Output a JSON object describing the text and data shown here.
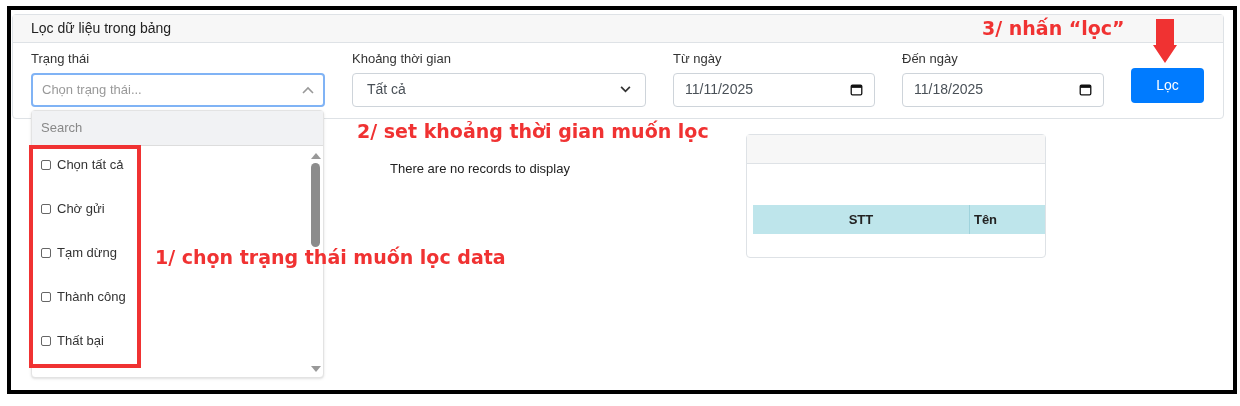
{
  "filter_panel": {
    "title": "Lọc dữ liệu trong bảng",
    "status_field": {
      "label": "Trạng thái",
      "placeholder": "Chọn trạng thái...",
      "expanded": true
    },
    "period_field": {
      "label": "Khoảng thời gian",
      "value": "Tất cả"
    },
    "from_date": {
      "label": "Từ ngày",
      "value": "11/11/2025"
    },
    "to_date": {
      "label": "Đến ngày",
      "value": "11/18/2025"
    },
    "filter_button": "Lọc"
  },
  "status_dropdown": {
    "search_placeholder": "Search",
    "options": [
      {
        "label": "Chọn tất cả",
        "checked": false
      },
      {
        "label": "Chờ gửi",
        "checked": false
      },
      {
        "label": "Tạm dừng",
        "checked": false
      },
      {
        "label": "Thành công",
        "checked": false
      },
      {
        "label": "Thất bại",
        "checked": false
      }
    ]
  },
  "empty_message": "There are no records to display",
  "table": {
    "columns": [
      "STT",
      "Tên"
    ]
  },
  "annotations": [
    {
      "kind": "step-status",
      "text": "1/ chọn trạng thái muốn lọc data"
    },
    {
      "kind": "step-period",
      "text": "2/ set khoảng thời gian muốn lọc"
    },
    {
      "kind": "step-button",
      "text": "3/ nhấn “lọc”"
    }
  ]
}
